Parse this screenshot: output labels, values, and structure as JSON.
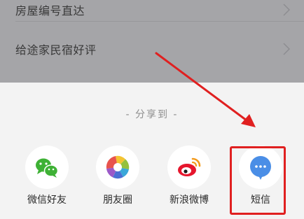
{
  "list": {
    "items": [
      {
        "label": "房屋编号直达"
      },
      {
        "label": "给途家民宿好评"
      }
    ]
  },
  "share_sheet": {
    "title": "- 分享到 -",
    "targets": [
      {
        "label": "微信好友",
        "icon": "wechat-icon"
      },
      {
        "label": "朋友圈",
        "icon": "moments-icon"
      },
      {
        "label": "新浪微博",
        "icon": "weibo-icon"
      },
      {
        "label": "短信",
        "icon": "sms-icon"
      }
    ]
  },
  "colors": {
    "overlay": "#a5a5a8",
    "sheet_background": "#f3f3f3",
    "annotation_red": "#e02020",
    "wechat_green": "#3eb135",
    "sms_blue": "#4a8ee6",
    "weibo_red": "#e6162d"
  }
}
